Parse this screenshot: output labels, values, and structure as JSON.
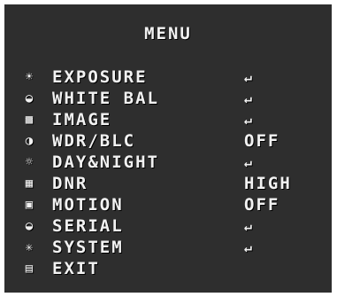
{
  "menu": {
    "title": "MENU",
    "items": [
      {
        "icon": "sun-icon",
        "glyph": "☀",
        "label": "EXPOSURE",
        "value": "↵"
      },
      {
        "icon": "palette-icon",
        "glyph": "◒",
        "label": "WHITE BAL",
        "value": "↵"
      },
      {
        "icon": "picture-icon",
        "glyph": "▩",
        "label": "IMAGE",
        "value": "↵"
      },
      {
        "icon": "half-circle-icon",
        "glyph": "◑",
        "label": "WDR/BLC",
        "value": "OFF"
      },
      {
        "icon": "day-night-icon",
        "glyph": "☼",
        "label": "DAY&NIGHT",
        "value": "↵"
      },
      {
        "icon": "noise-icon",
        "glyph": "▦",
        "label": "DNR",
        "value": "HIGH"
      },
      {
        "icon": "motion-icon",
        "glyph": "▣",
        "label": "MOTION",
        "value": "OFF"
      },
      {
        "icon": "serial-icon",
        "glyph": "◒",
        "label": "SERIAL",
        "value": "↵"
      },
      {
        "icon": "system-icon",
        "glyph": "✳",
        "label": "SYSTEM",
        "value": "↵"
      },
      {
        "icon": "exit-icon",
        "glyph": "▤",
        "label": "EXIT",
        "value": ""
      }
    ]
  }
}
